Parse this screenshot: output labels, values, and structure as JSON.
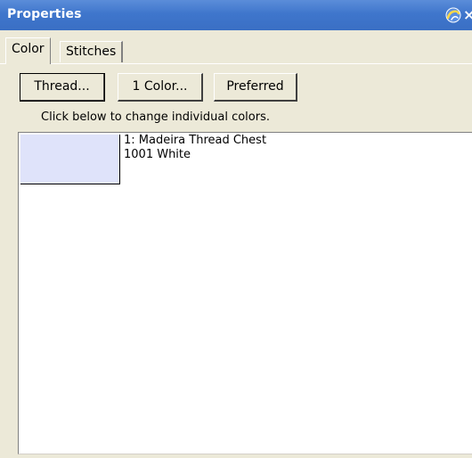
{
  "window": {
    "title": "Properties",
    "pin_icon": "pin-icon",
    "close_icon": "close-icon",
    "close_glyph": "×"
  },
  "tabs": [
    {
      "label": "Color",
      "selected": true
    },
    {
      "label": "Stitches",
      "selected": false
    }
  ],
  "toolbar": {
    "thread_label": "Thread...",
    "one_color_label": "1 Color...",
    "preferred_label": "Preferred"
  },
  "hint_text": "Click below to change individual colors.",
  "colors_list": [
    {
      "line1": "1: Madeira Thread Chest",
      "line2": "1001 White",
      "swatch_color": "#dfe3fa"
    }
  ],
  "theme": {
    "titlebar_color": "#3f76cc",
    "panel_color": "#ece9d8"
  }
}
